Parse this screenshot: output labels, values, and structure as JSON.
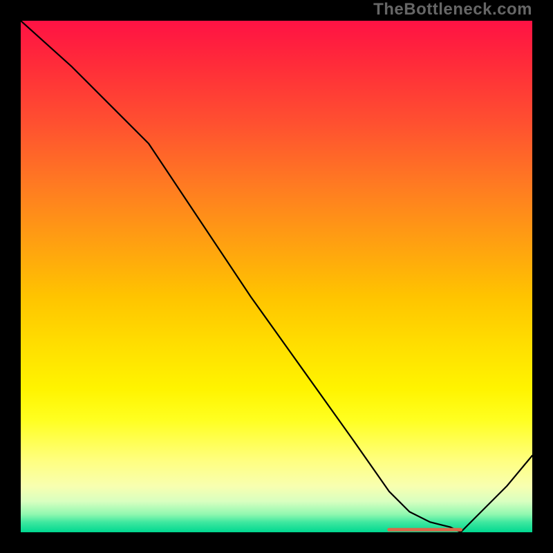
{
  "watermark": "TheBottleneck.com",
  "chart_data": {
    "type": "line",
    "title": "",
    "xlabel": "",
    "ylabel": "",
    "xlim": [
      0,
      100
    ],
    "ylim": [
      0,
      100
    ],
    "grid": false,
    "legend": false,
    "annotations": [
      {
        "kind": "highlight-segment",
        "x_start": 72,
        "x_end": 86,
        "y": 0.5,
        "color": "#d86a4a"
      }
    ],
    "series": [
      {
        "name": "curve",
        "x": [
          0,
          10,
          18,
          25,
          35,
          45,
          55,
          65,
          72,
          76,
          80,
          84,
          86,
          90,
          95,
          100
        ],
        "values": [
          100,
          91,
          83,
          76,
          61,
          46,
          32,
          18,
          8,
          4,
          2,
          1,
          0,
          4,
          9,
          15
        ]
      }
    ]
  }
}
